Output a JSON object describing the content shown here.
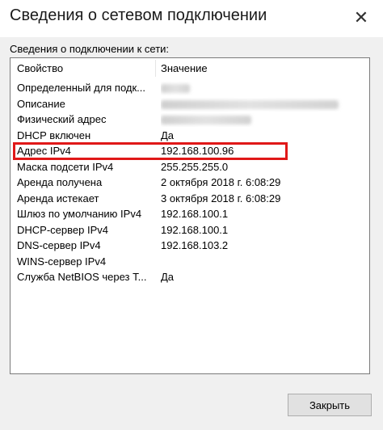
{
  "window": {
    "title": "Сведения о сетевом подключении",
    "close_glyph": "✕"
  },
  "group_label": "Сведения о подключении к сети:",
  "list": {
    "columns": [
      "Свойство",
      "Значение"
    ],
    "rows": [
      {
        "property": "Определенный для подк...",
        "value": ""
      },
      {
        "property": "Описание",
        "value": ""
      },
      {
        "property": "Физический адрес",
        "value": ""
      },
      {
        "property": "DHCP включен",
        "value": "Да"
      },
      {
        "property": "Адрес IPv4",
        "value": "192.168.100.96"
      },
      {
        "property": "Маска подсети IPv4",
        "value": "255.255.255.0"
      },
      {
        "property": "Аренда получена",
        "value": "2 октября 2018 г. 6:08:29"
      },
      {
        "property": "Аренда истекает",
        "value": "3 октября 2018 г. 6:08:29"
      },
      {
        "property": "Шлюз по умолчанию IPv4",
        "value": "192.168.100.1"
      },
      {
        "property": "DHCP-сервер IPv4",
        "value": "192.168.100.1"
      },
      {
        "property": "DNS-сервер IPv4",
        "value": "192.168.103.2"
      },
      {
        "property": "WINS-сервер IPv4",
        "value": ""
      },
      {
        "property": "Служба NetBIOS через Т...",
        "value": "Да"
      }
    ],
    "highlighted_row": "Адрес IPv4",
    "highlight_color": "#e01818"
  },
  "buttons": {
    "close_label": "Закрыть"
  }
}
